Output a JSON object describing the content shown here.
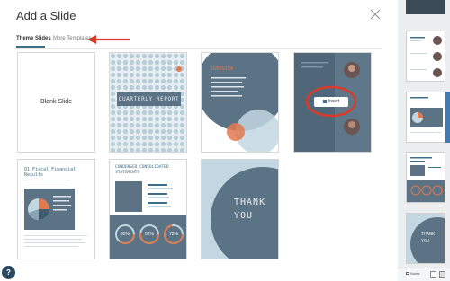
{
  "dialog": {
    "title": "Add a Slide",
    "tabs": [
      {
        "label": "Theme Slides",
        "active": true
      },
      {
        "label": "More Templates",
        "active": false
      }
    ]
  },
  "slides": {
    "blank": {
      "label": "Blank Slide"
    },
    "quarterly": {
      "title": "QUARTERLY REPORT"
    },
    "overview": {
      "heading": "OVERVIEW"
    },
    "insert": {
      "button_label": "Insert"
    },
    "financial": {
      "title_line1": "Q1 Fiscal Financial",
      "title_line2": "Results"
    },
    "consolidated": {
      "title_line1": "CONDENSED CONSOLIDATED",
      "title_line2": "STATEMENTS",
      "stats": [
        "35%",
        "52%",
        "72%"
      ]
    },
    "thank_you": {
      "line1": "THANK",
      "line2": "YOU"
    }
  },
  "bottom_bar": {
    "notes_label": "Notes"
  },
  "help": {
    "label": "?"
  },
  "colors": {
    "slate": "#5b7384",
    "teal_dark": "#3f5d6f",
    "light_blue": "#c3d7e2",
    "orange": "#e07a4f",
    "red_annotation": "#d93a2b",
    "tab_accent": "#3d6f8a"
  }
}
